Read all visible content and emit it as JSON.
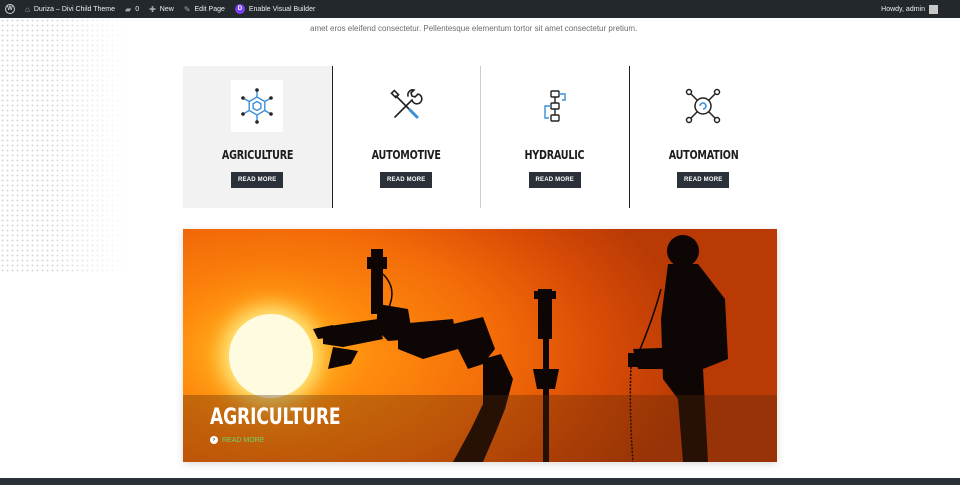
{
  "admin_bar": {
    "site_name": "Duriza – Divi Child Theme",
    "comments_count": "0",
    "new_label": "New",
    "edit_label": "Edit Page",
    "divi_letter": "D",
    "visual_builder_label": "Enable Visual Builder",
    "howdy_label": "Howdy, admin"
  },
  "intro_text": "amet eros eleifend consectetur. Pellentesque elementum tortor sit amet consectetur pretium.",
  "services": [
    {
      "title": "AGRICULTURE",
      "button": "READ MORE",
      "icon": "hexagon-network-icon"
    },
    {
      "title": "AUTOMOTIVE",
      "button": "READ MORE",
      "icon": "wrench-screwdriver-icon"
    },
    {
      "title": "HYDRAULIC",
      "button": "READ MORE",
      "icon": "flowchart-icon"
    },
    {
      "title": "AUTOMATION",
      "button": "READ MORE",
      "icon": "gear-nodes-icon"
    }
  ],
  "hero": {
    "title": "AGRICULTURE",
    "link_label": "READ MORE"
  },
  "colors": {
    "admin_bar": "#23282d",
    "button_bg": "#2b3138",
    "link_green": "#6fd36a",
    "icon_blue": "#3b8fd6"
  }
}
